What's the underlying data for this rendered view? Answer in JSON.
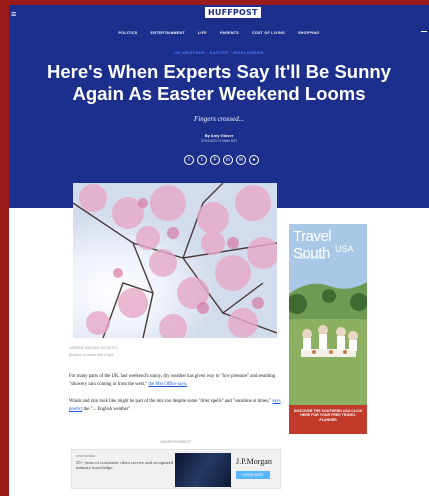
{
  "header": {
    "menu_glyph": "≡",
    "logo": "HUFFPOST",
    "nav": [
      "POLITICS",
      "ENTERTAINMENT",
      "LIFE",
      "PARENTS",
      "COST OF LIVING",
      "SHOPPING"
    ]
  },
  "article": {
    "kicker": "UK WEATHER · EASTER · WORLDNEWS",
    "headline": "Here's When Experts Say It'll Be Sunny Again As Easter Weekend Looms",
    "subhead": "Fingers crossed...",
    "byline": "By Amy Glover",
    "dateline": "07/04/2023 07:00am BST",
    "share_icons": [
      "facebook-icon",
      "twitter-icon",
      "flipboard-icon",
      "linkedin-icon",
      "email-icon",
      "copy-link-icon"
    ],
    "share_glyphs": [
      "f",
      "t",
      "F",
      "in",
      "✉",
      "●"
    ],
    "caption_line1": "GEORGE WALKER VIA GETTY",
    "caption_line2": "Blossom in cherry tree in April",
    "para1_a": "For many parts of the UK, last weekend's sunny, dry weather has given way to \"low pressure\" and resulting \"showery rain coming in from the west,\" ",
    "para1_link": "the Met Office says.",
    "para2_a": "Winds and rain look like ",
    "para2_a2": "might be part of the mix too despite some \"drier spells\" and \"sunshine at times,\" ",
    "para2_link": "says predict",
    "para2_b": " the \"... English weather\"."
  },
  "ads": {
    "label": "ADVERTISEMENT",
    "banner_sponsor": "SPONSORED",
    "banner_text": "25+ years of consistent client service and recognized industry knowledge.",
    "banner_brand": "J.P.Morgan",
    "banner_cta": "LEARN MORE",
    "side_title": "Travel South",
    "side_usa": "USA",
    "side_sub": "Life At Its Fullest",
    "side_cta": "DISCOVER THE SOUTHERN USA CLICK HERE FOR YOUR FREE TRAVEL PLANNER"
  },
  "colors": {
    "hero_bg": "#1d2f8c",
    "page_border": "#9b1b1b",
    "link": "#1d58d4",
    "kicker": "#4b7bff"
  }
}
